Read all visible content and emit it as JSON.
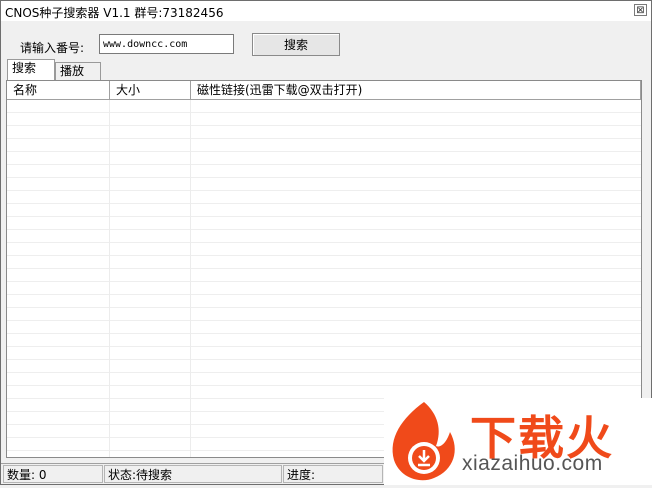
{
  "window": {
    "title": "CNOS种子搜索器 V1.1 群号:73182456",
    "close_glyph": "⊠"
  },
  "search": {
    "label": "请输入番号:",
    "value": "www.downcc.com",
    "button_label": "搜索"
  },
  "tabs": [
    {
      "label": "搜索",
      "active": true
    },
    {
      "label": "播放",
      "active": false
    }
  ],
  "table": {
    "columns": [
      "名称",
      "大小",
      "磁性链接(迅雷下载@双击打开)"
    ],
    "rows": []
  },
  "status": {
    "count": "数量: 0",
    "state": "状态:待搜索",
    "progress": "进度:"
  },
  "watermark": {
    "brand_cn": "下载火",
    "brand_url": "xiazaihuo.com"
  },
  "colors": {
    "accent": "#f04a1a",
    "window_bg": "#f0f0f0"
  }
}
